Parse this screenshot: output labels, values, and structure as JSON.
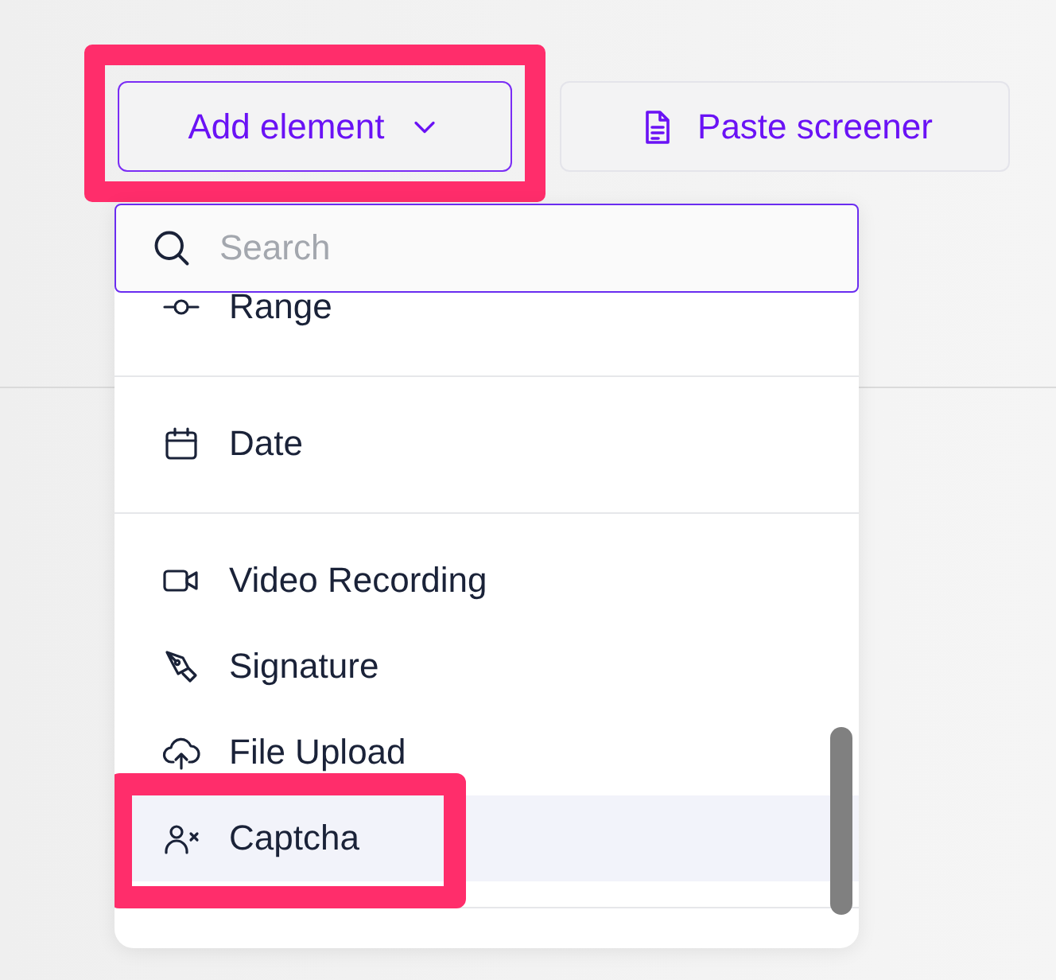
{
  "toolbar": {
    "buttons": [
      {
        "label": "Add element",
        "kind": "dropdown",
        "highlighted": true
      },
      {
        "label": "Paste screener",
        "kind": "document",
        "highlighted": false
      }
    ]
  },
  "menu": {
    "search": {
      "placeholder": "Search"
    },
    "groups": [
      {
        "items": [
          {
            "label": "Range",
            "kind": "range",
            "hovered": false,
            "highlighted": false
          }
        ]
      },
      {
        "items": [
          {
            "label": "Date",
            "kind": "date",
            "hovered": false,
            "highlighted": false
          }
        ]
      },
      {
        "items": [
          {
            "label": "Video Recording",
            "kind": "video",
            "hovered": false,
            "highlighted": false
          },
          {
            "label": "Signature",
            "kind": "signature",
            "hovered": false,
            "highlighted": false
          },
          {
            "label": "File Upload",
            "kind": "upload",
            "hovered": false,
            "highlighted": false
          },
          {
            "label": "Captcha",
            "kind": "captcha",
            "hovered": true,
            "highlighted": true
          }
        ]
      }
    ]
  }
}
